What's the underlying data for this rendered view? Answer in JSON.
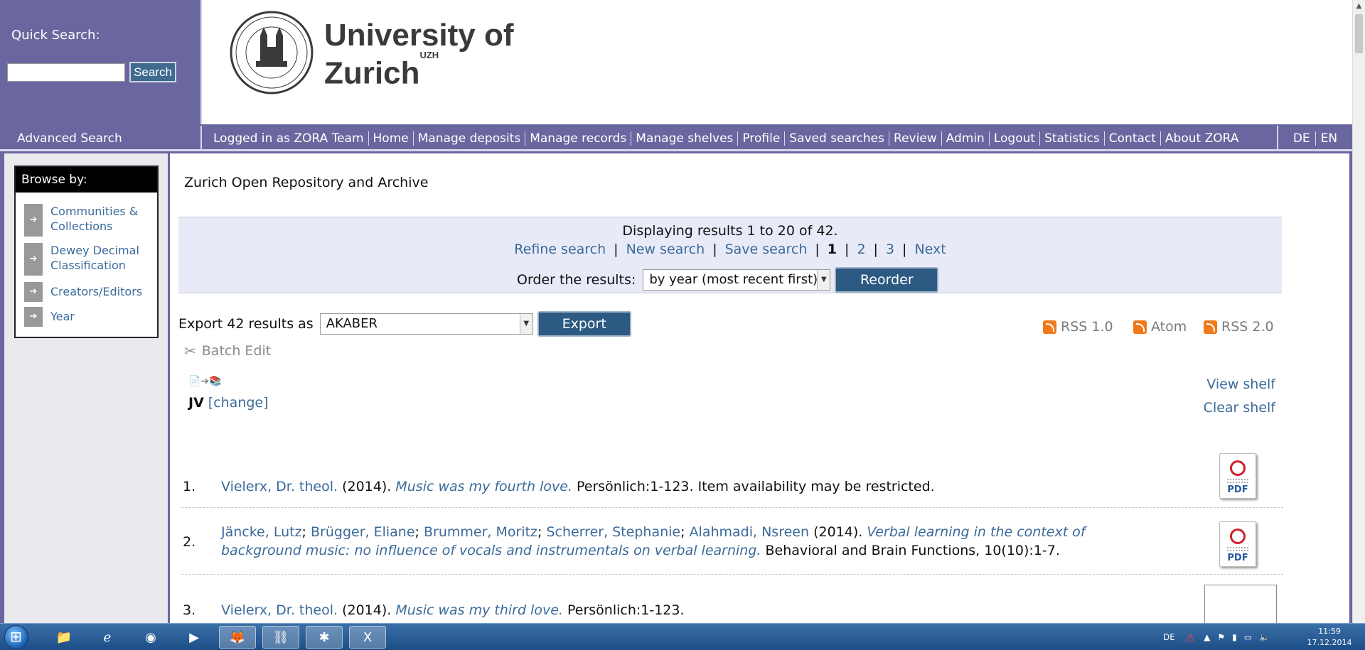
{
  "quick_search": {
    "label": "Quick Search:",
    "button": "Search",
    "value": ""
  },
  "logo": {
    "line1": "University of",
    "line2": "Zurich",
    "sup": "UZH"
  },
  "nav": {
    "advanced": "Advanced Search",
    "links": [
      "Logged in as ZORA Team",
      "Home",
      "Manage deposits",
      "Manage records",
      "Manage shelves",
      "Profile",
      "Saved searches",
      "Review",
      "Admin",
      "Logout",
      "Statistics",
      "Contact",
      "About ZORA"
    ],
    "lang": [
      "DE",
      "EN"
    ]
  },
  "sidebar": {
    "heading": "Browse by:",
    "items": [
      {
        "label": "Communities & Collections"
      },
      {
        "label": "Dewey Decimal Classification"
      },
      {
        "label": "Creators/Editors"
      },
      {
        "label": "Year"
      }
    ]
  },
  "main": {
    "repo_title": "Zurich Open Repository and Archive",
    "results_summary": "Displaying results 1 to 20 of 42.",
    "actions": [
      "Refine search",
      "New search",
      "Save search"
    ],
    "pages": [
      "1",
      "2",
      "3"
    ],
    "current_page": "1",
    "next": "Next",
    "order_label": "Order the results:",
    "order_value": "by year (most recent first)",
    "reorder_button": "Reorder",
    "export_label": "Export 42 results as",
    "export_format": "AKABER",
    "export_button": "Export",
    "feeds": [
      "RSS 1.0",
      "Atom",
      "RSS 2.0"
    ],
    "batch_edit": "Batch Edit",
    "shelf_name": "JV",
    "shelf_change": "[change]",
    "view_shelf": "View shelf",
    "clear_shelf": "Clear shelf"
  },
  "results": [
    {
      "num": "1.",
      "authors": [
        "Vielerx, Dr. theol."
      ],
      "year": "(2014).",
      "title": "Music was my fourth love.",
      "source": "Persönlich:1-123. Item availability may be restricted.",
      "thumb": "PDF"
    },
    {
      "num": "2.",
      "authors": [
        "Jäncke, Lutz",
        "Brügger, Eliane",
        "Brummer, Moritz",
        "Scherrer, Stephanie",
        "Alahmadi, Nsreen"
      ],
      "year": "(2014).",
      "title_line1": "Verbal learning in the context of",
      "title_line2": "background music: no influence of vocals and instrumentals on verbal learning.",
      "source": "Behavioral and Brain Functions, 10(10):1-7.",
      "thumb": "PDF"
    },
    {
      "num": "3.",
      "authors": [
        "Vielerx, Dr. theol."
      ],
      "year": "(2014).",
      "title": "Music was my third love.",
      "source": "Persönlich:1-123."
    }
  ],
  "taskbar": {
    "tray_lang": "DE",
    "time": "11:59",
    "date": "17.12.2014"
  },
  "colors": {
    "nav_bg": "#6a67a0",
    "link": "#3a6a9a",
    "button": "#2c5a82"
  }
}
